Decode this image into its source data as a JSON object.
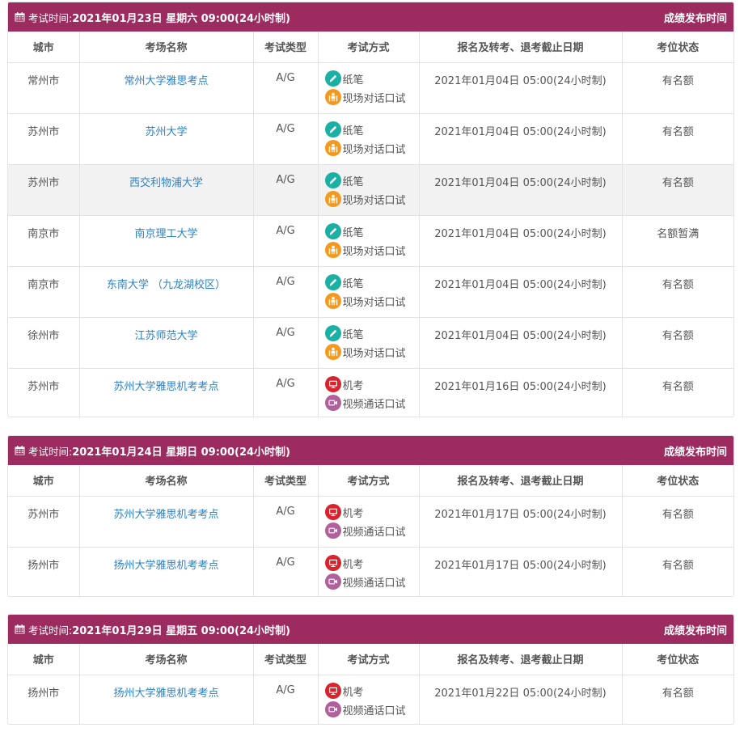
{
  "colors": {
    "header_bg": "#9c2b5f",
    "link": "#2a82c8",
    "paper": "#1ab0a3",
    "speaking": "#f39a1e",
    "computer": "#d9232d",
    "video": "#b0609b"
  },
  "common": {
    "exam_prefix": "考试时间:",
    "results_label": "成绩发布时间",
    "col_city": "城市",
    "col_venue": "考场名称",
    "col_type": "考试类型",
    "col_method": "考试方式",
    "col_deadline": "报名及转考、退考截止日期",
    "col_status": "考位状态",
    "paper": "纸笔",
    "speaking": "现场对话口试",
    "computer": "机考",
    "video": "视频通话口试"
  },
  "blocks": [
    {
      "date": "2021年01月23日 星期六 09:00(24小时制)",
      "rows": [
        {
          "city": "常州市",
          "venue": "常州大学雅思考点",
          "type": "A/G",
          "deadline": "2021年01月04日 05:00(24小时制)",
          "status": "有名额"
        },
        {
          "city": "苏州市",
          "venue": "苏州大学",
          "type": "A/G",
          "deadline": "2021年01月04日 05:00(24小时制)",
          "status": "有名额"
        },
        {
          "city": "苏州市",
          "venue": "西交利物浦大学",
          "type": "A/G",
          "deadline": "2021年01月04日 05:00(24小时制)",
          "status": "有名额"
        },
        {
          "city": "南京市",
          "venue": "南京理工大学",
          "type": "A/G",
          "deadline": "2021年01月04日 05:00(24小时制)",
          "status": "名额暂满"
        },
        {
          "city": "南京市",
          "venue": "东南大学 （九龙湖校区）",
          "type": "A/G",
          "deadline": "2021年01月04日 05:00(24小时制)",
          "status": "有名额"
        },
        {
          "city": "徐州市",
          "venue": "江苏师范大学",
          "type": "A/G",
          "deadline": "2021年01月04日 05:00(24小时制)",
          "status": "有名额"
        },
        {
          "city": "苏州市",
          "venue": "苏州大学雅思机考考点",
          "type": "A/G",
          "deadline": "2021年01月16日 05:00(24小时制)",
          "status": "有名额"
        }
      ]
    },
    {
      "date": "2021年01月24日 星期日 09:00(24小时制)",
      "rows": [
        {
          "city": "苏州市",
          "venue": "苏州大学雅思机考考点",
          "type": "A/G",
          "deadline": "2021年01月17日 05:00(24小时制)",
          "status": "有名额"
        },
        {
          "city": "扬州市",
          "venue": "扬州大学雅思机考考点",
          "type": "A/G",
          "deadline": "2021年01月17日 05:00(24小时制)",
          "status": "有名额"
        }
      ]
    },
    {
      "date": "2021年01月29日 星期五 09:00(24小时制)",
      "rows": [
        {
          "city": "扬州市",
          "venue": "扬州大学雅思机考考点",
          "type": "A/G",
          "deadline": "2021年01月22日 05:00(24小时制)",
          "status": "有名额"
        }
      ]
    }
  ]
}
